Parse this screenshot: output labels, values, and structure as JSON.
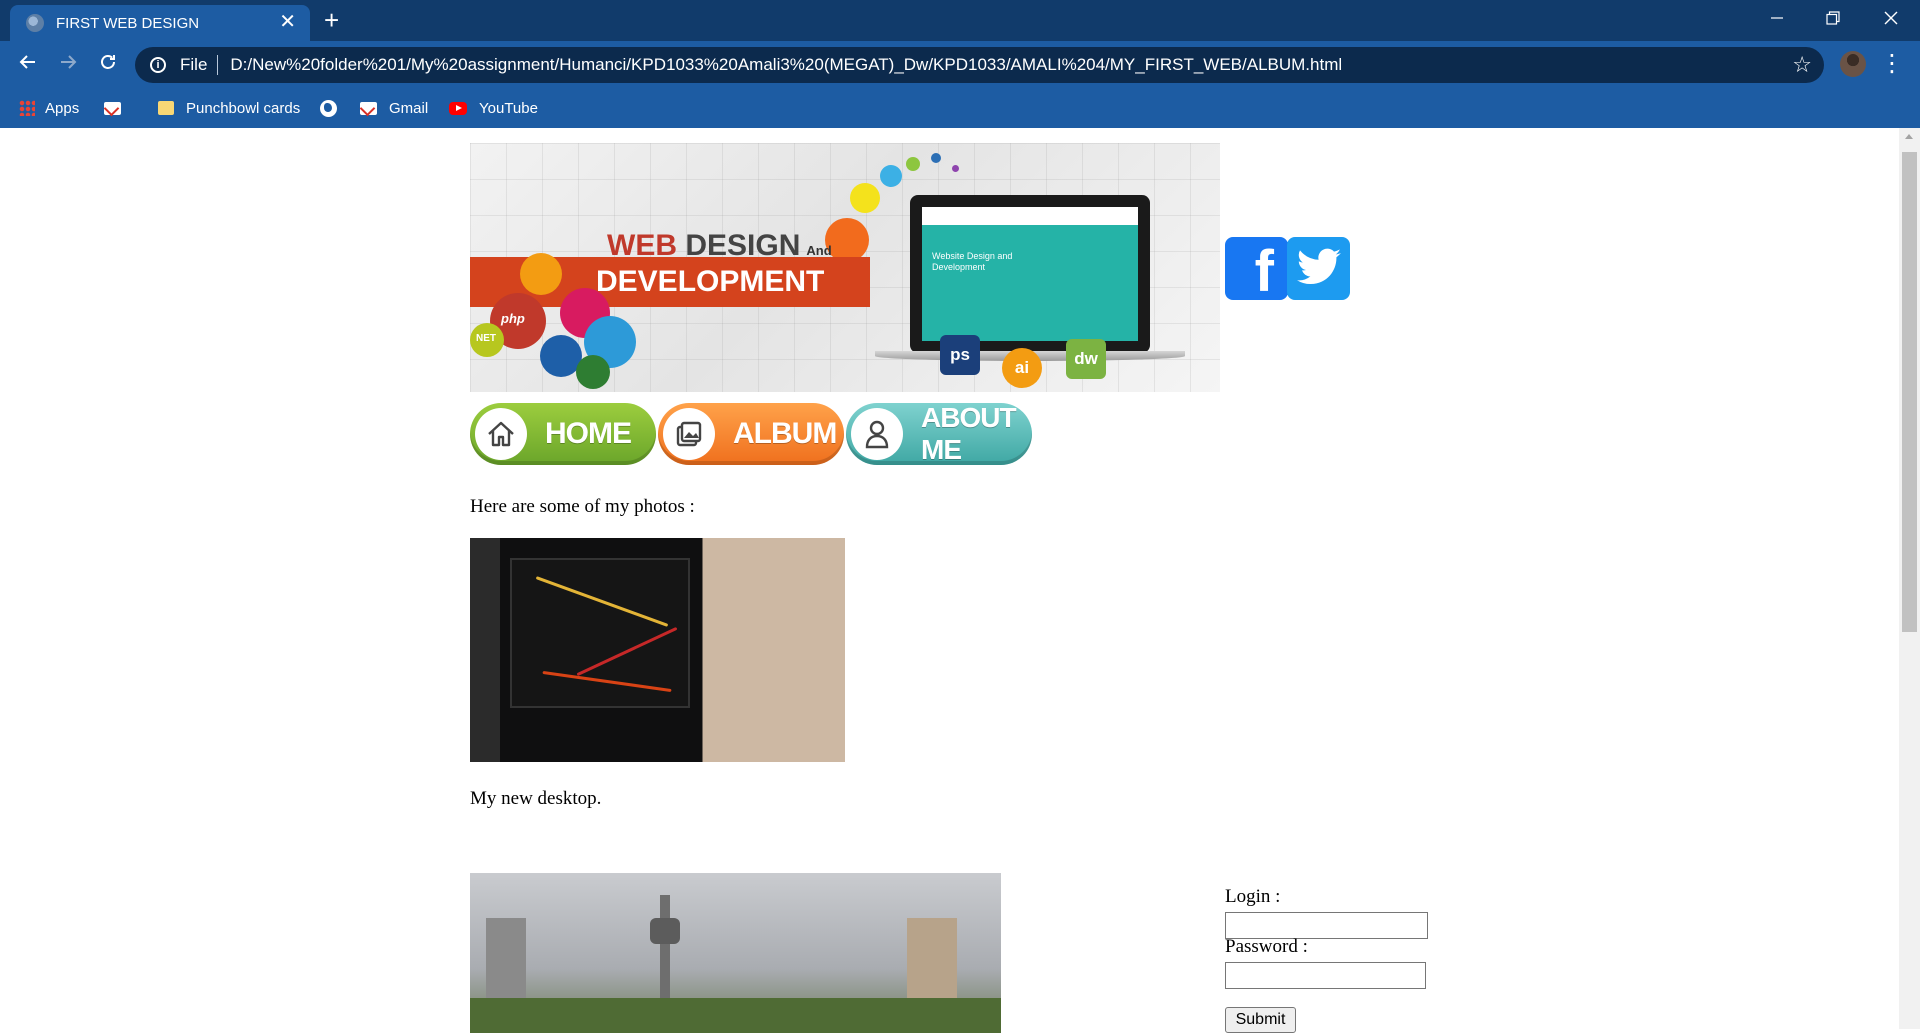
{
  "browser": {
    "tab_title": "FIRST WEB DESIGN",
    "tab_close": "✕",
    "new_tab": "+",
    "scheme_label": "File",
    "url": "D:/New%20folder%201/My%20assignment/Humanci/KPD1033%20Amali3%20(MEGAT)_Dw/KPD1033/AMALI%204/MY_FIRST_WEB/ALBUM.html",
    "icons": {
      "back": "arrow-left-icon",
      "forward": "arrow-right-icon",
      "reload": "reload-icon",
      "info": "info-icon",
      "bookmark_star": "star-icon",
      "menu": "kebab-menu-icon"
    }
  },
  "bookmarks": [
    {
      "label": "Apps",
      "icon": "apps-grid-icon"
    },
    {
      "label": "",
      "icon": "gmail-icon"
    },
    {
      "label": "Punchbowl cards",
      "icon": "folder-icon"
    },
    {
      "label": "",
      "icon": "globe-icon"
    },
    {
      "label": "Gmail",
      "icon": "gmail-icon"
    },
    {
      "label": "YouTube",
      "icon": "youtube-icon"
    }
  ],
  "banner": {
    "word_web": "WEB",
    "word_design": "DESIGN",
    "word_and": "And",
    "word_development": "DEVELOPMENT",
    "laptop_text": "Website Design and Development",
    "bubbles": [
      "php",
      "NET"
    ],
    "tools": [
      "ps",
      "ai",
      "dw"
    ]
  },
  "social": {
    "facebook": "f",
    "twitter": "twitter-bird-icon"
  },
  "nav": {
    "home": "HOME",
    "album": "ALBUM",
    "about": "ABOUT ME"
  },
  "content": {
    "intro": "Here are some of my photos :",
    "caption1": "My new desktop."
  },
  "login": {
    "login_label": "Login :",
    "password_label": "Password :",
    "submit": "Submit"
  },
  "colors": {
    "titlebar": "#113b6b",
    "toolbar": "#1d5ca3",
    "home_button": "#7fba32",
    "album_button": "#f5872f",
    "about_button": "#5bbcb8",
    "facebook": "#1877f2",
    "twitter": "#1d9bf0"
  }
}
